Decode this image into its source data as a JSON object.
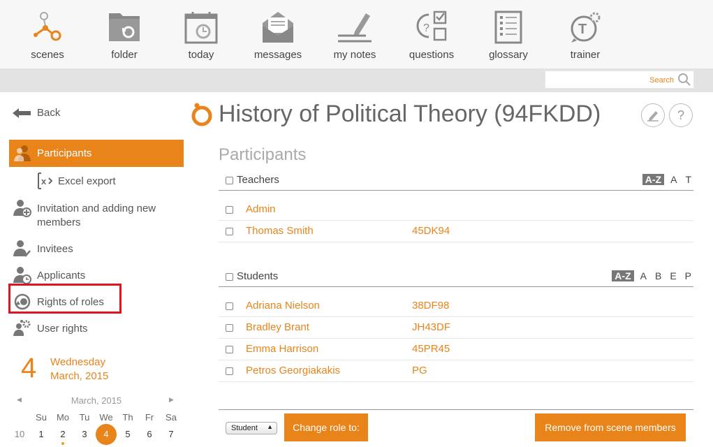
{
  "toolbar": {
    "items": [
      {
        "label": "scenes",
        "icon": "scenes-icon"
      },
      {
        "label": "folder",
        "icon": "folder-icon"
      },
      {
        "label": "today",
        "icon": "calendar-icon"
      },
      {
        "label": "messages",
        "icon": "envelope-icon"
      },
      {
        "label": "my notes",
        "icon": "pencil-icon"
      },
      {
        "label": "questions",
        "icon": "questions-icon"
      },
      {
        "label": "glossary",
        "icon": "glossary-icon"
      },
      {
        "label": "trainer",
        "icon": "trainer-icon"
      }
    ]
  },
  "search": {
    "placeholder": "Search"
  },
  "sidebar": {
    "back_label": "Back",
    "items": [
      {
        "label": "Participants",
        "active": true
      },
      {
        "label": "Excel export"
      },
      {
        "label": "Invitation and adding new members"
      },
      {
        "label": "Invitees"
      },
      {
        "label": "Applicants"
      },
      {
        "label": "Rights of roles"
      },
      {
        "label": "User rights"
      }
    ]
  },
  "date": {
    "day_number": "4",
    "weekday": "Wednesday",
    "month_year": "March, 2015"
  },
  "calendar": {
    "month": "March, 2015",
    "weekdays": [
      "Su",
      "Mo",
      "Tu",
      "We",
      "Th",
      "Fr",
      "Sa"
    ],
    "week_number": "10",
    "days": [
      "1",
      "2",
      "3",
      "4",
      "5",
      "6",
      "7"
    ],
    "today": "4"
  },
  "main": {
    "title": "History of Political Theory (94FKDD)",
    "section_title": "Participants",
    "teachers": {
      "title": "Teachers",
      "sort": [
        "A-Z",
        "A",
        "T"
      ],
      "rows": [
        {
          "name": "Admin",
          "code": ""
        },
        {
          "name": "Thomas Smith",
          "code": "45DK94"
        }
      ]
    },
    "students": {
      "title": "Students",
      "sort": [
        "A-Z",
        "A",
        "B",
        "E",
        "P"
      ],
      "rows": [
        {
          "name": "Adriana Nielson",
          "code": "38DF98"
        },
        {
          "name": "Bradley Brant",
          "code": "JH43DF"
        },
        {
          "name": "Emma Harrison",
          "code": "45PR45"
        },
        {
          "name": "Petros Georgiakakis",
          "code": "PG"
        }
      ]
    },
    "role_select": "Student",
    "change_role_label": "Change role to:",
    "remove_label": "Remove from scene members"
  },
  "colors": {
    "accent": "#e8841a",
    "highlight": "#e0141e"
  }
}
